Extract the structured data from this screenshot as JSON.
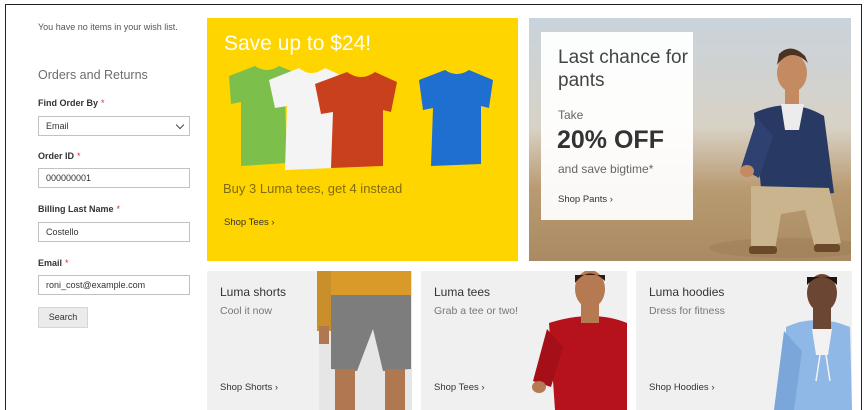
{
  "sidebar": {
    "wishlist_text": "You have no items in your wish list.",
    "orders_title": "Orders and Returns",
    "find_order_by": {
      "label": "Find Order By",
      "required": "*",
      "value": "Email"
    },
    "order_id": {
      "label": "Order ID",
      "required": "*",
      "value": "000000001"
    },
    "billing_last_name": {
      "label": "Billing Last Name",
      "required": "*",
      "value": "Costello"
    },
    "email": {
      "label": "Email",
      "required": "*",
      "value": "roni_cost@example.com"
    },
    "search_label": "Search"
  },
  "banners": {
    "tees_promo": {
      "title": "Save up to $24!",
      "subtitle": "Buy 3 Luma tees, get 4 instead",
      "link": "Shop Tees ›"
    },
    "pants_promo": {
      "title": "Last chance for pants",
      "take": "Take",
      "discount": "20% OFF",
      "save": "and save bigtime*",
      "link": "Shop Pants ›"
    },
    "shorts": {
      "title": "Luma shorts",
      "subtitle": "Cool it now",
      "link": "Shop Shorts ›"
    },
    "tees": {
      "title": "Luma tees",
      "subtitle": "Grab a tee or two!",
      "link": "Shop Tees ›"
    },
    "hoodies": {
      "title": "Luma hoodies",
      "subtitle": "Dress for fitness",
      "link": "Shop Hoodies ›"
    }
  },
  "colors": {
    "yellow": "#ffd500",
    "required": "#e02b27",
    "tee_green": "#7cc04b",
    "tee_white": "#f4f4f4",
    "tee_orange": "#c9401d",
    "tee_blue": "#1f6fd1"
  }
}
